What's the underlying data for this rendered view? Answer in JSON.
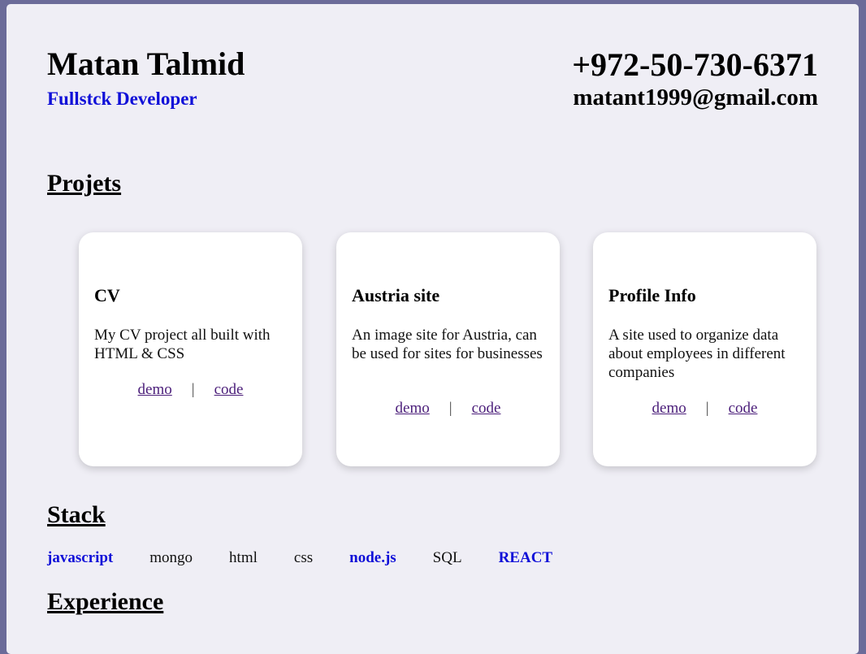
{
  "header": {
    "name": "Matan Talmid",
    "role": "Fullstck Developer",
    "phone": "+972-50-730-6371",
    "email": "matant1999@gmail.com"
  },
  "projects": {
    "title": "Projets",
    "items": [
      {
        "title": "CV",
        "description": "My CV project all built with HTML & CSS",
        "demo": "demo",
        "separator": "|",
        "code": "code"
      },
      {
        "title": "Austria site",
        "description": "An image site for Austria, can be used for sites for businesses",
        "demo": "demo",
        "separator": "|",
        "code": "code"
      },
      {
        "title": "Profile Info",
        "description": "A site used to organize data about employees in different companies",
        "demo": "demo",
        "separator": "|",
        "code": "code"
      }
    ]
  },
  "stack": {
    "title": "Stack",
    "items": [
      {
        "label": "javascript",
        "highlight": true
      },
      {
        "label": "mongo",
        "highlight": false
      },
      {
        "label": "html",
        "highlight": false
      },
      {
        "label": "css",
        "highlight": false
      },
      {
        "label": "node.js",
        "highlight": true
      },
      {
        "label": "SQL",
        "highlight": false
      },
      {
        "label": "REACT",
        "highlight": true
      }
    ]
  },
  "experience": {
    "title": "Experience"
  },
  "colors": {
    "page_border": "#6b6b99",
    "sheet_bg": "#efeef5",
    "accent_blue": "#1010d8",
    "link_visited": "#4b1e7a"
  }
}
